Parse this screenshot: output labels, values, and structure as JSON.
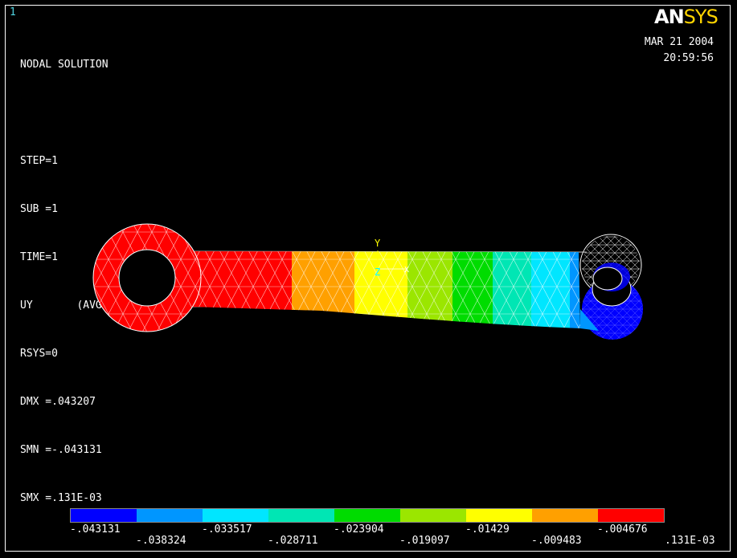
{
  "window_number": "1",
  "logo": {
    "an": "AN",
    "sys": "SYS"
  },
  "info_lines": [
    "NODAL SOLUTION",
    "",
    "STEP=1",
    "SUB =1",
    "TIME=1",
    "UY       (AVG)",
    "RSYS=0",
    "DMX =.043207",
    "SMN =-.043131",
    "SMX =.131E-03"
  ],
  "date": "MAR 21 2004",
  "time": "20:59:56",
  "triad": {
    "y": "Y",
    "z": "Z",
    "x": "X"
  },
  "legend": {
    "colors": [
      "#0000ff",
      "#0096ff",
      "#00e6ff",
      "#00e6b4",
      "#00dc00",
      "#9be600",
      "#ffff00",
      "#ffa000",
      "#ff0000"
    ],
    "labels_top": [
      "-.043131",
      "-.033517",
      "-.023904",
      "-.01429",
      "-.004676"
    ],
    "labels_bottom": [
      "-.038324",
      "-.028711",
      "-.019097",
      "-.009483",
      ".131E-03"
    ]
  }
}
